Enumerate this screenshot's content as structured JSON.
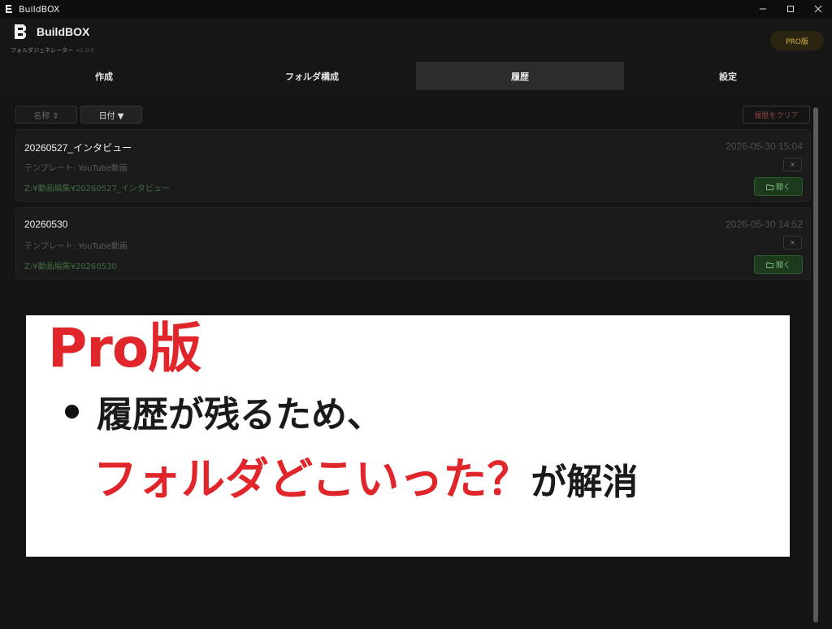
{
  "window": {
    "title": "BuildBOX",
    "controls": [
      "minimize",
      "maximize",
      "close"
    ]
  },
  "app": {
    "brand": "BuildBOX",
    "subtitle": "フォルダジェネレーター",
    "version": "v1.0.0",
    "pro_badge": "PRO版"
  },
  "tabs": [
    {
      "label": "作成",
      "active": false
    },
    {
      "label": "フォルダ構成",
      "active": false
    },
    {
      "label": "履歴",
      "active": true
    },
    {
      "label": "設定",
      "active": false
    }
  ],
  "toolbar": {
    "sort_name": "名称 ⇕",
    "sort_date": "日付 ▼",
    "clear": "履歴をクリア"
  },
  "history": [
    {
      "name": "20260527_インタビュー",
      "date": "2026-05-30 15:04",
      "template": "テンプレート: YouTube動画",
      "path": "Z:¥動画編集¥20260527_インタビュー",
      "delete": "×",
      "open": "開く"
    },
    {
      "name": "20260530",
      "date": "2026-05-30 14:52",
      "template": "テンプレート: YouTube動画",
      "path": "Z:¥動画編集¥20260530",
      "delete": "×",
      "open": "開く"
    }
  ],
  "promo": {
    "title": "Pro版",
    "line1": "履歴が残るため、",
    "line2_red": "フォルダどこいった？",
    "line2_dark": "が解消"
  },
  "colors": {
    "accent_red": "#e0262b",
    "pro_gold": "#d9b24a",
    "open_green": "#7fbf7f"
  }
}
